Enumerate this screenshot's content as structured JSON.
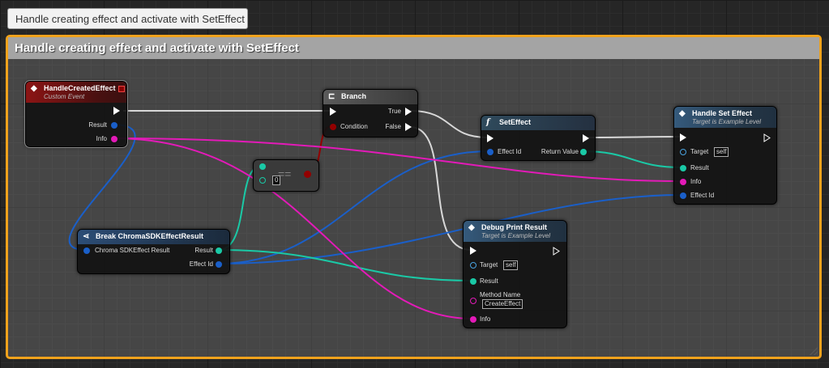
{
  "tooltip": "Handle creating effect and activate with SetEffect",
  "comment": {
    "title": "Handle creating effect and activate with SetEffect"
  },
  "colors": {
    "exec": "#ffffff",
    "struct_blue": "#0e5fc9",
    "teal": "#1ac9a6",
    "magenta": "#e31ab8",
    "bool_red": "#930000",
    "comment_border": "#f0a21c"
  },
  "nodes": {
    "handle_created": {
      "title": "HandleCreatedEffect",
      "subtitle": "Custom Event",
      "pin_result": "Result",
      "pin_info": "Info",
      "icon": "event-diamond-icon"
    },
    "branch": {
      "title": "Branch",
      "pin_condition": "Condition",
      "pin_true": "True",
      "pin_false": "False",
      "icon": "branch-icon"
    },
    "equals": {
      "symbol": "==",
      "value": "0"
    },
    "set_effect": {
      "title": "SetEffect",
      "pin_effect_id": "Effect Id",
      "pin_return": "Return Value",
      "icon": "function-icon"
    },
    "handle_set": {
      "title": "Handle Set Effect",
      "subtitle": "Target is Example Level",
      "pin_target": "Target",
      "target_value": "self",
      "pin_result": "Result",
      "pin_info": "Info",
      "pin_effect_id": "Effect Id",
      "icon": "event-diamond-icon"
    },
    "break_result": {
      "title": "Break ChromaSDKEffectResult",
      "pin_input": "Chroma SDKEffect Result",
      "pin_result": "Result",
      "pin_effect_id": "Effect Id",
      "icon": "break-struct-icon"
    },
    "debug_print": {
      "title": "Debug Print Result",
      "subtitle": "Target is Example Level",
      "pin_target": "Target",
      "target_value": "self",
      "pin_result": "Result",
      "pin_method": "Method Name",
      "method_value": "CreateEffect",
      "pin_info": "Info",
      "icon": "event-diamond-icon"
    }
  }
}
